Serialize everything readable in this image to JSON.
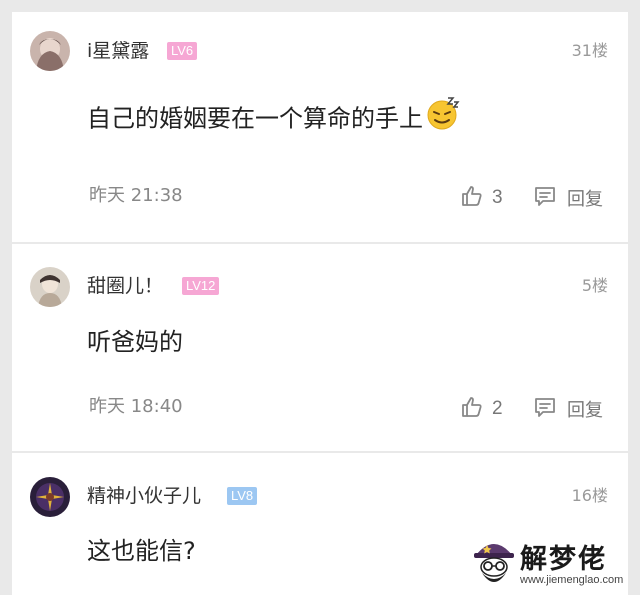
{
  "colors": {
    "level_pink": "#f6a7d4",
    "level_blue": "#9cc7f2",
    "text_primary": "#222222",
    "text_secondary": "#888888",
    "icon_gray": "#888888"
  },
  "comments": [
    {
      "username": "i星黛露",
      "level": "LV6",
      "floor": "31楼",
      "content": "自己的婚姻要在一个算命的手上",
      "content_emoji": "sweat-smile-emoji",
      "time": "昨天 21:38",
      "likes": "3",
      "reply_label": "回复"
    },
    {
      "username": "甜圈儿！",
      "level": "LV12",
      "floor": "5楼",
      "content": "听爸妈的",
      "time": "昨天 18:40",
      "likes": "2",
      "reply_label": "回复"
    },
    {
      "username": "精神小伙子儿",
      "level": "LV8",
      "floor": "16楼",
      "content": "这也能信?"
    }
  ],
  "watermark": {
    "title": "解梦佬",
    "url": "www.jiemenglao.com"
  }
}
